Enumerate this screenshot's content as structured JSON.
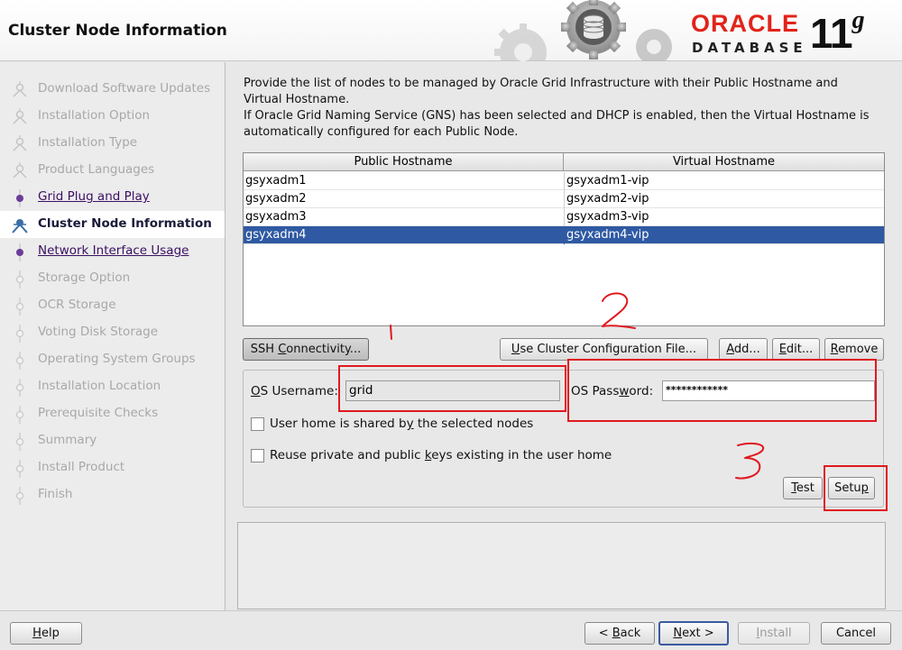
{
  "header": {
    "title": "Cluster Node Information",
    "brand": "ORACLE",
    "product": "DATABASE",
    "version": "11",
    "version_suffix": "g"
  },
  "sidebar": {
    "steps": [
      {
        "label": "Download Software Updates",
        "state": "done"
      },
      {
        "label": "Installation Option",
        "state": "done"
      },
      {
        "label": "Installation Type",
        "state": "done"
      },
      {
        "label": "Product Languages",
        "state": "done"
      },
      {
        "label": "Grid Plug and Play",
        "state": "visited"
      },
      {
        "label": "Cluster Node Information",
        "state": "current"
      },
      {
        "label": "Network Interface Usage",
        "state": "visited"
      },
      {
        "label": "Storage Option",
        "state": "pending"
      },
      {
        "label": "OCR Storage",
        "state": "pending"
      },
      {
        "label": "Voting Disk Storage",
        "state": "pending"
      },
      {
        "label": "Operating System Groups",
        "state": "pending"
      },
      {
        "label": "Installation Location",
        "state": "pending"
      },
      {
        "label": "Prerequisite Checks",
        "state": "pending"
      },
      {
        "label": "Summary",
        "state": "pending"
      },
      {
        "label": "Install Product",
        "state": "pending"
      },
      {
        "label": "Finish",
        "state": "pending"
      }
    ]
  },
  "main": {
    "description_line1": "Provide the list of nodes to be managed by Oracle Grid Infrastructure with their Public Hostname and",
    "description_line2": "Virtual Hostname.",
    "description_line3": "If Oracle Grid Naming Service (GNS) has been selected and DHCP is enabled, then the Virtual Hostname is",
    "description_line4": "automatically configured for each Public Node.",
    "table": {
      "columns": [
        "Public Hostname",
        "Virtual Hostname"
      ],
      "rows": [
        [
          "gsyxadm1",
          "gsyxadm1-vip"
        ],
        [
          "gsyxadm2",
          "gsyxadm2-vip"
        ],
        [
          "gsyxadm3",
          "gsyxadm3-vip"
        ],
        [
          "gsyxadm4",
          "gsyxadm4-vip"
        ]
      ],
      "selected_row": 3
    },
    "buttons": {
      "ssh": {
        "pre": "SSH ",
        "key": "C",
        "post": "onnectivity..."
      },
      "config_file": {
        "pre": "",
        "key": "U",
        "post": "se Cluster Configuration File..."
      },
      "add": {
        "pre": "",
        "key": "A",
        "post": "dd..."
      },
      "edit": {
        "pre": "",
        "key": "E",
        "post": "dit..."
      },
      "remove": {
        "pre": "",
        "key": "R",
        "post": "emove"
      }
    },
    "ssh_panel": {
      "username_label_key": "O",
      "username_label_rest": "S Username:",
      "username_value": "grid",
      "password_label_pre": "OS Pass",
      "password_label_key": "w",
      "password_label_post": "ord:",
      "password_value": "************",
      "shared_home_pre": "User home is shared b",
      "shared_home_key": "y",
      "shared_home_post": " the selected nodes",
      "reuse_keys_pre": "Reuse private and public ",
      "reuse_keys_key": "k",
      "reuse_keys_post": "eys existing in the user home",
      "test": {
        "key": "T",
        "post": "est"
      },
      "setup": {
        "pre": "Setu",
        "key": "p"
      }
    }
  },
  "footer": {
    "help": {
      "key": "H",
      "post": "elp"
    },
    "back": {
      "pre": "< ",
      "key": "B",
      "post": "ack"
    },
    "next": {
      "key": "N",
      "post": "ext >"
    },
    "install": {
      "key": "I",
      "post": "nstall"
    },
    "cancel": "Cancel"
  },
  "annotations": {
    "one": "1",
    "two": "2",
    "three": "3",
    "color": "#e0191f"
  }
}
